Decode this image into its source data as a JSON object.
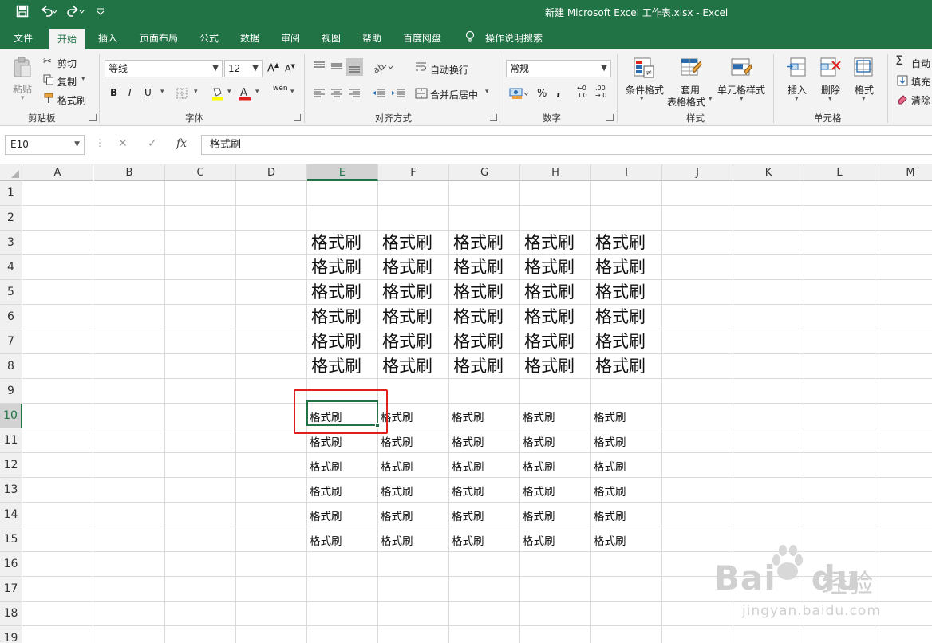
{
  "window": {
    "title": "新建 Microsoft Excel 工作表.xlsx  -  Excel",
    "brand_color": "#217346"
  },
  "quick_access": {
    "save_icon": "save-icon",
    "undo_icon": "undo-icon",
    "redo_icon": "redo-icon",
    "customize_icon": "customize-icon"
  },
  "tabs": [
    "文件",
    "开始",
    "插入",
    "页面布局",
    "公式",
    "数据",
    "审阅",
    "视图",
    "帮助",
    "百度网盘"
  ],
  "active_tab": "开始",
  "tell_me": "操作说明搜索",
  "ribbon": {
    "clipboard": {
      "paste": "粘贴",
      "cut": "剪切",
      "copy": "复制",
      "format_painter": "格式刷",
      "label": "剪贴板"
    },
    "font": {
      "font_name": "等线",
      "font_size": "12",
      "grow": "A",
      "shrink": "A",
      "bold": "B",
      "italic": "I",
      "underline": "U",
      "phonetic": "wén",
      "label": "字体"
    },
    "alignment": {
      "wrap_text": "自动换行",
      "merge_center": "合并后居中",
      "label": "对齐方式"
    },
    "number": {
      "format": "常规",
      "percent": "%",
      "comma": ",",
      "inc_decimal": ".00",
      "dec_decimal": ".0",
      "label": "数字"
    },
    "styles": {
      "conditional": "条件格式",
      "table_format_1": "套用",
      "table_format_2": "表格格式",
      "cell_styles": "单元格样式",
      "label": "样式"
    },
    "cells": {
      "insert": "插入",
      "delete": "删除",
      "format": "格式",
      "label": "单元格"
    },
    "editing": {
      "autosum": "自动",
      "fill": "填充",
      "clear": "清除"
    }
  },
  "formula_bar": {
    "name_box": "E10",
    "cancel": "✕",
    "enter": "✓",
    "fx": "fx",
    "content": "格式刷"
  },
  "sheet": {
    "columns": [
      "A",
      "B",
      "C",
      "D",
      "E",
      "F",
      "G",
      "H",
      "I",
      "J",
      "K",
      "L",
      "M"
    ],
    "rows": [
      "1",
      "2",
      "3",
      "4",
      "5",
      "6",
      "7",
      "8",
      "9",
      "10",
      "11",
      "12",
      "13",
      "14",
      "15",
      "16",
      "17",
      "18",
      "19"
    ],
    "selected_column": "E",
    "selected_row": "10",
    "cell_text": "格式刷",
    "large_rows": [
      "3",
      "4",
      "5",
      "6",
      "7",
      "8"
    ],
    "small_rows": [
      "10",
      "11",
      "12",
      "13",
      "14",
      "15"
    ],
    "filled_columns": [
      "E",
      "F",
      "G",
      "H",
      "I"
    ],
    "highlight_color": "#e0201a"
  },
  "watermark": {
    "text": "Bai",
    "text2": "du",
    "cn": "经验",
    "url": "jingyan.baidu.com"
  }
}
